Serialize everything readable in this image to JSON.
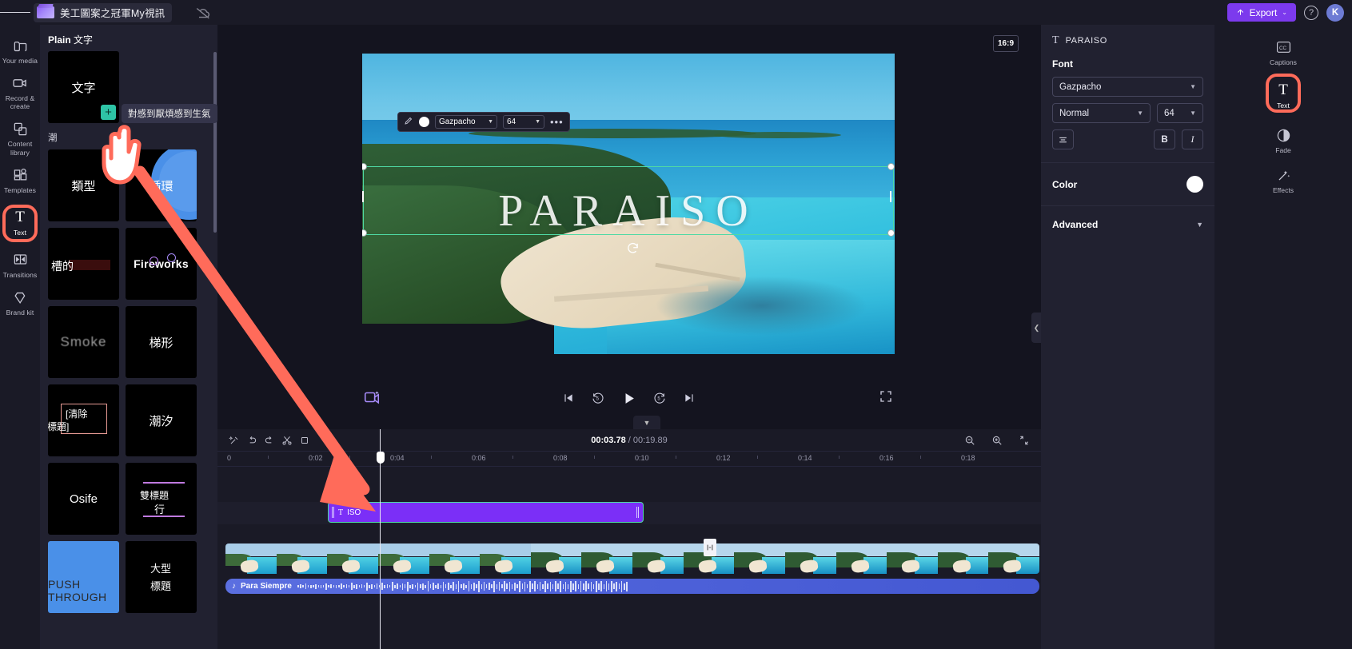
{
  "topbar": {
    "menu_icon": "hamburger-icon",
    "project_name": "美工圖案之冠軍My視訊",
    "cloud_icon": "cloud-off-icon",
    "export_label": "Export",
    "export_chevron": "⌄",
    "help_label": "?",
    "avatar_initial": "K",
    "export_color": "#7c3aed"
  },
  "left_rail": {
    "items": [
      {
        "label": "Your media",
        "icon": "folder-icon",
        "active": false
      },
      {
        "label": "Record & create",
        "icon": "camera-icon",
        "active": false
      },
      {
        "label": "Content library",
        "icon": "library-icon",
        "active": false
      },
      {
        "label": "Templates",
        "icon": "templates-grid-icon",
        "active": false
      },
      {
        "label": "Text",
        "icon": "text-t-icon",
        "active": true
      },
      {
        "label": "Transitions",
        "icon": "transitions-icon",
        "active": false
      },
      {
        "label": "Brand kit",
        "icon": "brand-kit-icon",
        "active": false
      }
    ],
    "highlight_color": "#ff6b5a"
  },
  "left_panel": {
    "title_bold": "Plain",
    "title_rest": " 文字",
    "section_label": "潮",
    "tooltip": "對感到厭煩感到生氣",
    "add_badge": "+",
    "tiles": [
      {
        "label": "文字",
        "style": "plain"
      },
      {
        "label": "類型",
        "style": "plain"
      },
      {
        "label": "循環",
        "style": "circle"
      },
      {
        "label": "槽的",
        "style": "slot"
      },
      {
        "label": "Fireworks",
        "style": "fireworks"
      },
      {
        "label": "Smoke",
        "style": "smoke"
      },
      {
        "label": "梯形",
        "style": "plain"
      },
      {
        "label": "[清除標題]",
        "line1": "[清除",
        "line2": "標題]",
        "style": "clear"
      },
      {
        "label": "潮汐",
        "style": "plain"
      },
      {
        "label": "Osife",
        "style": "plain"
      },
      {
        "label": "雙標題行",
        "line1": "雙標題",
        "line2": "行",
        "style": "dual"
      },
      {
        "label": "PUSH THROUGH",
        "style": "push"
      },
      {
        "label": "大型標題",
        "line1": "大型",
        "line2": "標題",
        "style": "big"
      }
    ]
  },
  "preview": {
    "aspect_ratio": "16:9",
    "overlay_text": "PARAISO",
    "float_toolbar": {
      "pen_icon": "pencil-icon",
      "color_swatch": "#ffffff",
      "font": "Gazpacho",
      "size": "64",
      "more": "•••"
    },
    "transport": {
      "skip_start": "skip-to-start-icon",
      "back5": "back-5s-icon",
      "play": "play-icon",
      "fwd5": "forward-5s-icon",
      "skip_end": "skip-to-end-icon",
      "fullscreen": "fullscreen-icon",
      "magic": "auto-compose-icon"
    }
  },
  "timeline": {
    "toolbar_icons": [
      "split-magic-icon",
      "undo-icon",
      "redo-icon",
      "scissors-icon",
      "crop-icon"
    ],
    "current_time": "00:03.78",
    "separator": " / ",
    "total_time": "00:19.89",
    "zoom_out_icon": "zoom-out-icon",
    "zoom_in_icon": "zoom-in-icon",
    "fit_icon": "fit-timeline-icon",
    "ruler_labels": [
      "0",
      "0:02",
      "0:04",
      "0:06",
      "0:08",
      "0:10",
      "0:12",
      "0:14",
      "0:16",
      "0:18"
    ],
    "text_clip": {
      "label": "PARAISO",
      "short": "ISO",
      "prefix_icon": "text-t-icon",
      "color": "#7b2ff7"
    },
    "audio_clip": {
      "label": "Para Siempre",
      "icon": "music-note-icon"
    },
    "split_marker": "split-marker-icon"
  },
  "right_panel": {
    "header_icon": "text-t-icon",
    "header_title": "PARAISO",
    "font_label": "Font",
    "font_family": "Gazpacho",
    "font_weight": "Normal",
    "font_size": "64",
    "align_icon": "align-center-icon",
    "bold_label": "B",
    "italic_label": "I",
    "color_label": "Color",
    "color_value": "#ffffff",
    "advanced_label": "Advanced",
    "chevron": "⌄"
  },
  "right_rail": {
    "items": [
      {
        "label": "Captions",
        "icon": "cc-icon",
        "active": false
      },
      {
        "label": "Text",
        "icon": "text-t-icon",
        "active": true
      },
      {
        "label": "Fade",
        "icon": "fade-icon",
        "active": false
      },
      {
        "label": "Effects",
        "icon": "effects-wand-icon",
        "active": false
      }
    ],
    "highlight_color": "#ff6b5a"
  },
  "annotations": {
    "arrow_color": "#ff6b5a",
    "cursor": "hand-pointer-cursor"
  }
}
